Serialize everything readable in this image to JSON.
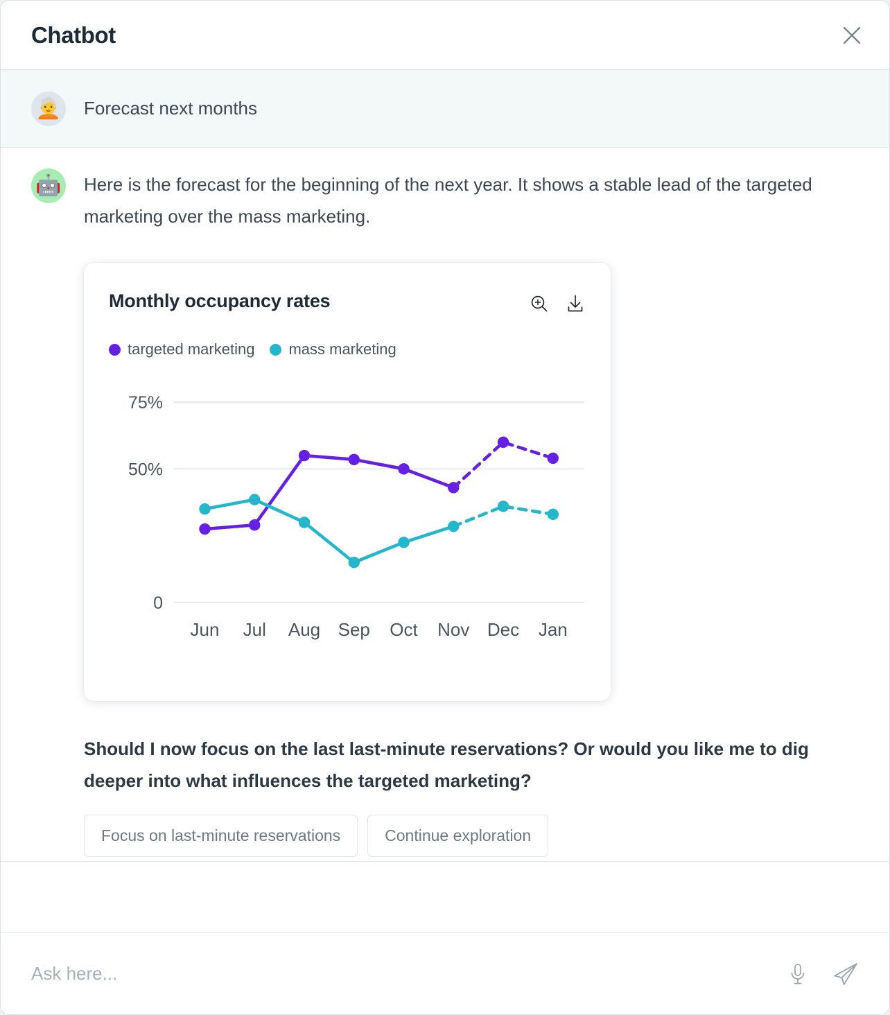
{
  "window": {
    "title": "Chatbot",
    "close_icon": "close-icon"
  },
  "conversation": {
    "user_message": {
      "avatar_emoji": "🧑‍🦳",
      "text": "Forecast next months"
    },
    "bot_message": {
      "avatar_emoji": "🤖",
      "text": "Here is the forecast for the beginning of the next year. It shows a stable lead of the targeted marketing over the mass marketing."
    },
    "followup_question": "Should I now focus on the last last-minute reservations? Or would you like me to dig deeper into what influences the targeted marketing?",
    "suggestions": [
      {
        "label": "Focus on last-minute reservations"
      },
      {
        "label": "Continue exploration"
      }
    ]
  },
  "chart_card": {
    "title": "Monthly occupancy rates",
    "actions": [
      {
        "name": "zoom-in-icon",
        "label": "Zoom in"
      },
      {
        "name": "download-icon",
        "label": "Download"
      }
    ]
  },
  "chart_data": {
    "type": "line",
    "title": "Monthly occupancy rates",
    "xlabel": "",
    "ylabel": "",
    "categories": [
      "Jun",
      "Jul",
      "Aug",
      "Sep",
      "Oct",
      "Nov",
      "Dec",
      "Jan"
    ],
    "ylim": [
      0,
      82
    ],
    "ytick_values": [
      0,
      50,
      75
    ],
    "ytick_labels": [
      "0",
      "50%",
      "75%"
    ],
    "grid": "horizontal",
    "legend_position": "top-left",
    "forecast_starts_after_index": 5,
    "forecast_style": "dashed",
    "series": [
      {
        "name": "targeted marketing",
        "color": "#6620e4",
        "values": [
          27.5,
          29,
          55,
          53.5,
          50,
          43,
          60,
          54
        ]
      },
      {
        "name": "mass marketing",
        "color": "#24b7cb",
        "values": [
          35,
          38.5,
          30,
          15,
          22.5,
          28.5,
          36,
          33
        ]
      }
    ]
  },
  "composer": {
    "placeholder": "Ask here...",
    "value": "",
    "mic_icon": "microphone-icon",
    "send_icon": "send-icon"
  }
}
